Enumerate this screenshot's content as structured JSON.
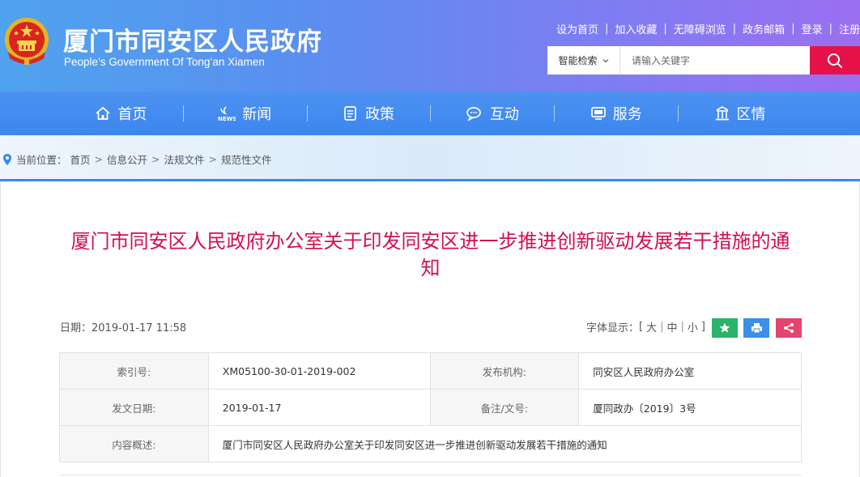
{
  "header": {
    "title": "厦门市同安区人民政府",
    "subtitle": "People’s Government Of Tong’an Xiamen",
    "emblem_icon": "national-emblem-icon",
    "top_links": [
      "设为首页",
      "加入收藏",
      "无障碍浏览",
      "政务邮箱",
      "登录",
      "注册"
    ]
  },
  "search": {
    "scope_label": "智能检索",
    "placeholder": "请输入关键字",
    "button_icon": "search-icon",
    "button_color": "#e5124a"
  },
  "nav": {
    "items": [
      {
        "label": "首页",
        "icon": "home-icon"
      },
      {
        "label": "新闻",
        "icon": "news-icon"
      },
      {
        "label": "政策",
        "icon": "document-icon"
      },
      {
        "label": "互动",
        "icon": "chat-icon"
      },
      {
        "label": "服务",
        "icon": "monitor-icon"
      },
      {
        "label": "区情",
        "icon": "building-icon"
      }
    ]
  },
  "breadcrumb": {
    "prefix": "当前位置：",
    "items": [
      "首页",
      "信息公开",
      "法规文件",
      "规范性文件"
    ],
    "separator": ">"
  },
  "article": {
    "title": "厦门市同安区人民政府办公室关于印发同安区进一步推进创新驱动发展若干措施的通知",
    "title_color": "#d0124c",
    "date_label": "日期：",
    "date": "2019-01-17 11:58",
    "font_size_label": "字体显示：",
    "font_sizes": [
      "大",
      "中",
      "小"
    ],
    "bracket_open": "[",
    "bracket_close": "]",
    "tools": [
      {
        "icon": "star-icon",
        "color": "#2cb36a"
      },
      {
        "icon": "print-icon",
        "color": "#3b8fe6"
      },
      {
        "icon": "share-icon",
        "color": "#e64470"
      }
    ]
  },
  "info_table": {
    "rows": [
      {
        "k1": "索引号:",
        "v1": "XM05100-30-01-2019-002",
        "k2": "发布机构:",
        "v2": "同安区人民政府办公室"
      },
      {
        "k1": "发文日期:",
        "v1": "2019-01-17",
        "k2": "备注/文号:",
        "v2": "厦同政办〔2019〕3号"
      },
      {
        "k1": "内容概述:",
        "v1": "厦门市同安区人民政府办公室关于印发同安区进一步推进创新驱动发展若干措施的通知"
      }
    ]
  }
}
